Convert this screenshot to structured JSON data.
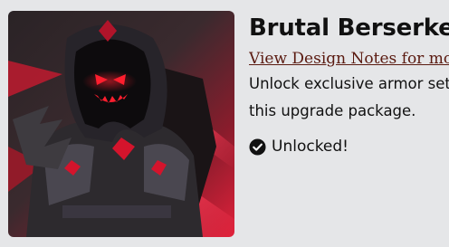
{
  "item": {
    "title": "Brutal Berserker",
    "design_notes_link": "View Design Notes for more info",
    "description": "Unlock exclusive armor sets in this upgrade package.",
    "status": "Unlocked!",
    "status_icon": "check-circle-icon",
    "image_subject": "hooded-berserker-artwork"
  },
  "colors": {
    "background": "#e5e6e8",
    "accent_red": "#e0213a",
    "link": "#5a1a10"
  }
}
